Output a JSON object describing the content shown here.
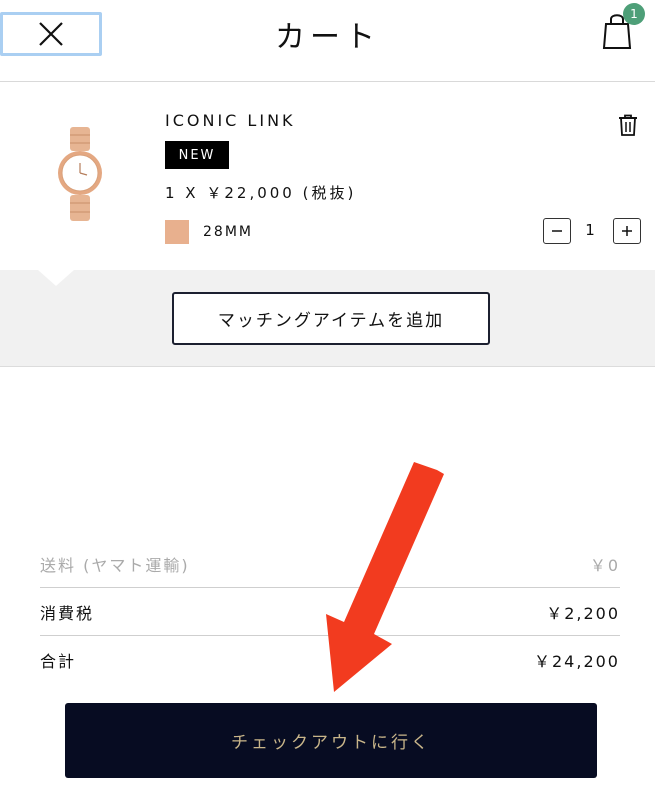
{
  "header": {
    "title": "カート",
    "cart_count": "1",
    "close_icon": "close-icon",
    "bag_icon": "shopping-bag-icon"
  },
  "item": {
    "name": "ICONIC LINK",
    "badge": "NEW",
    "price_line": "1 X ￥22,000 (税抜)",
    "size": "28MM",
    "swatch_color": "#e8b08e",
    "quantity": "1",
    "delete_icon": "trash-icon"
  },
  "matching": {
    "button_label": "マッチングアイテムを追加"
  },
  "summary": {
    "rows": [
      {
        "label": "送料 (ヤマト運輸)",
        "value": "￥0"
      },
      {
        "label": "消費税",
        "value": "￥2,200"
      },
      {
        "label": "合計",
        "value": "￥24,200"
      }
    ]
  },
  "checkout": {
    "label": "チェックアウトに行く",
    "bg_color": "#070c22",
    "text_color": "#c9b68a"
  },
  "annotation": {
    "arrow_color": "#f23b1f"
  }
}
